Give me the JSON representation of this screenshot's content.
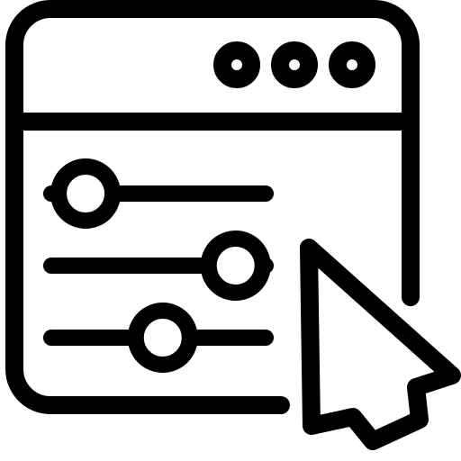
{
  "icon": {
    "name": "browser-settings-sliders-with-cursor-icon",
    "stroke_color": "#000000",
    "fill_color": "#ffffff",
    "window_control_dots": 3,
    "sliders": [
      {
        "name": "slider-1",
        "level": 0.16
      },
      {
        "name": "slider-2",
        "level": 0.86
      },
      {
        "name": "slider-3",
        "level": 0.52
      }
    ],
    "cursor": "arrow-pointer"
  }
}
